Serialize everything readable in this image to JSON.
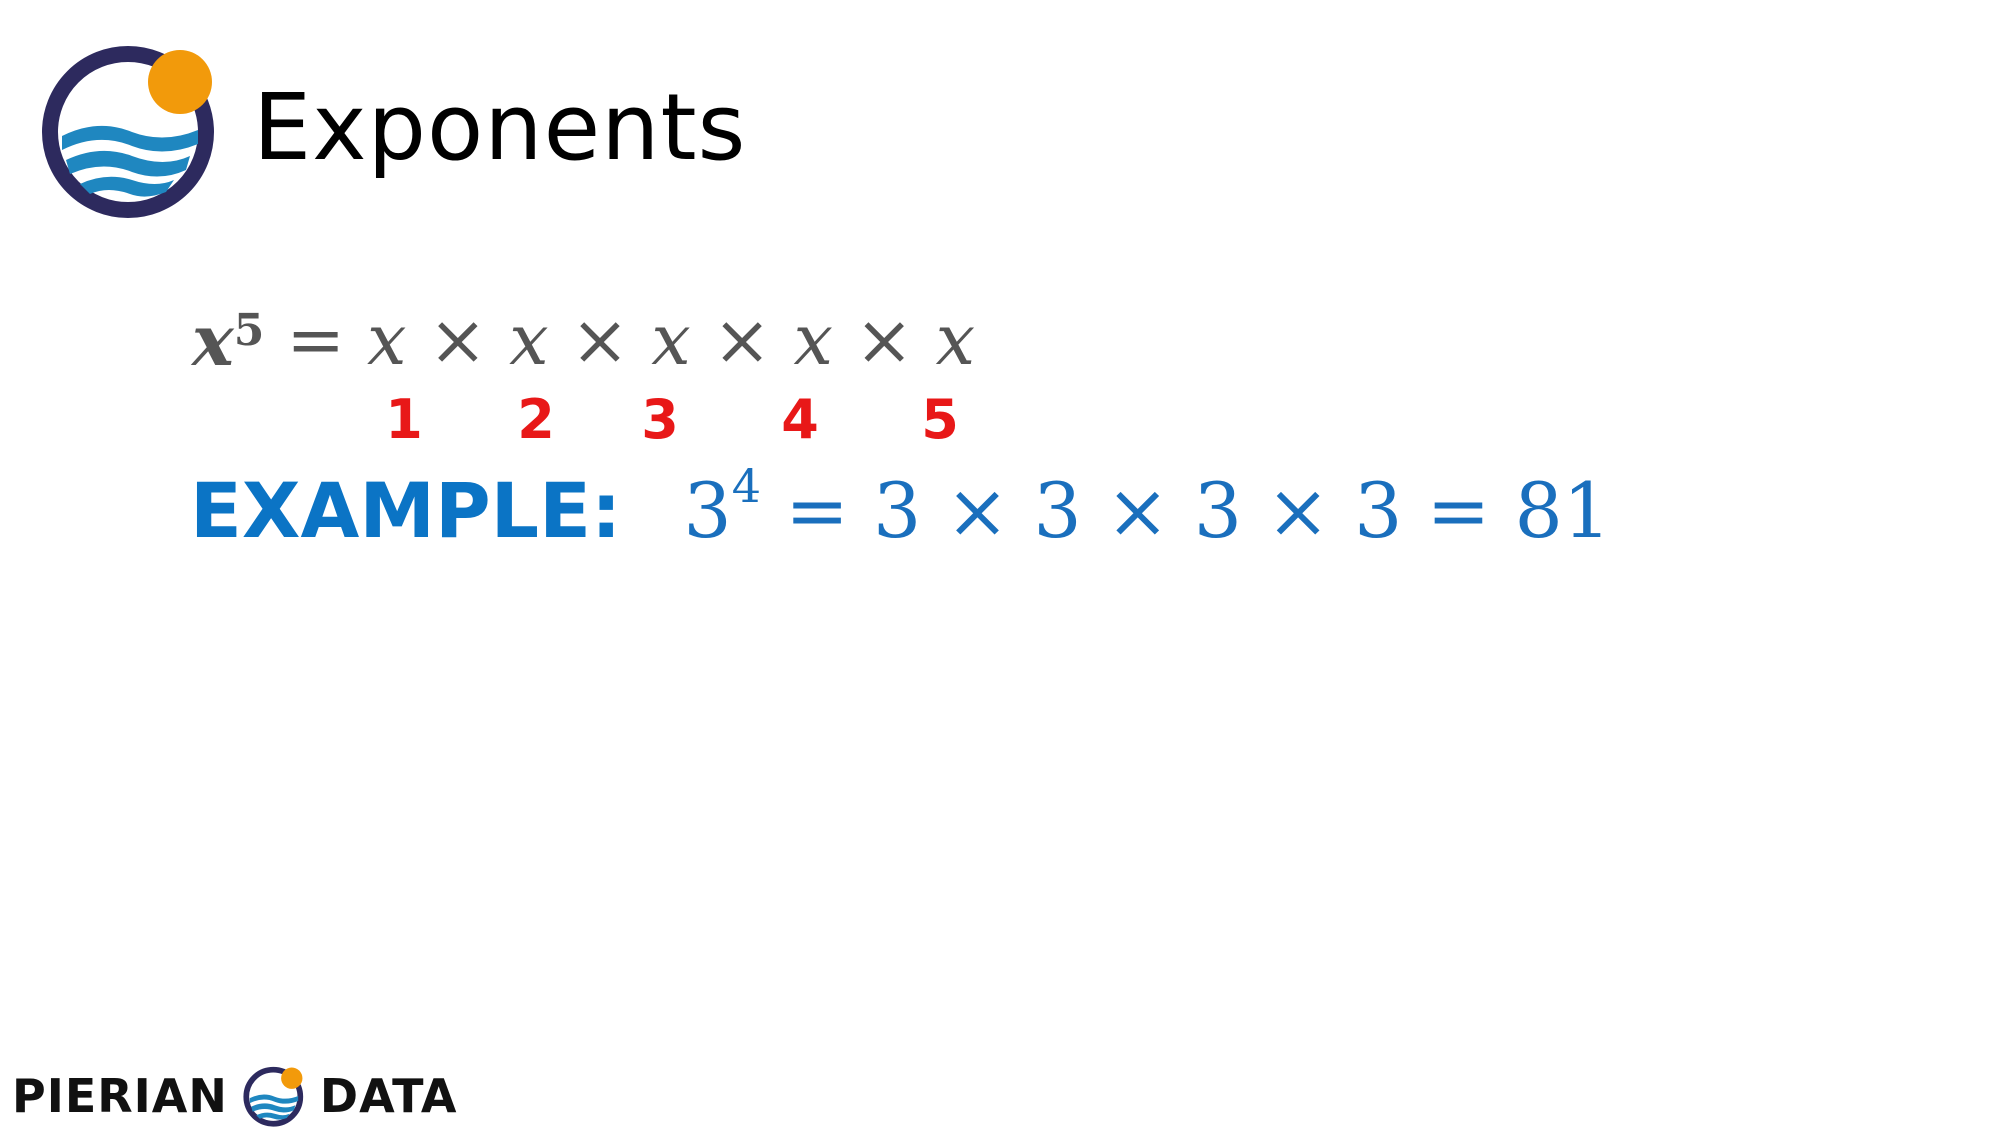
{
  "slide": {
    "title": "Exponents"
  },
  "formula": {
    "base": "x",
    "exponent": "5",
    "equals": "=",
    "factor": "x",
    "times": "×",
    "counts": [
      "1",
      "2",
      "3",
      "4",
      "5"
    ]
  },
  "example": {
    "label": "EXAMPLE:",
    "base": "3",
    "exponent": "4",
    "expansion": "= 3 × 3 × 3 × 3 = 81"
  },
  "footer": {
    "brand_left": "PIERIAN",
    "brand_right": "DATA"
  },
  "colors": {
    "accent_orange": "#f29a0b",
    "ring_navy": "#2d2a5e",
    "wave_blue": "#1f87c0",
    "example_blue": "#0b74c5",
    "count_red": "#e81818"
  }
}
